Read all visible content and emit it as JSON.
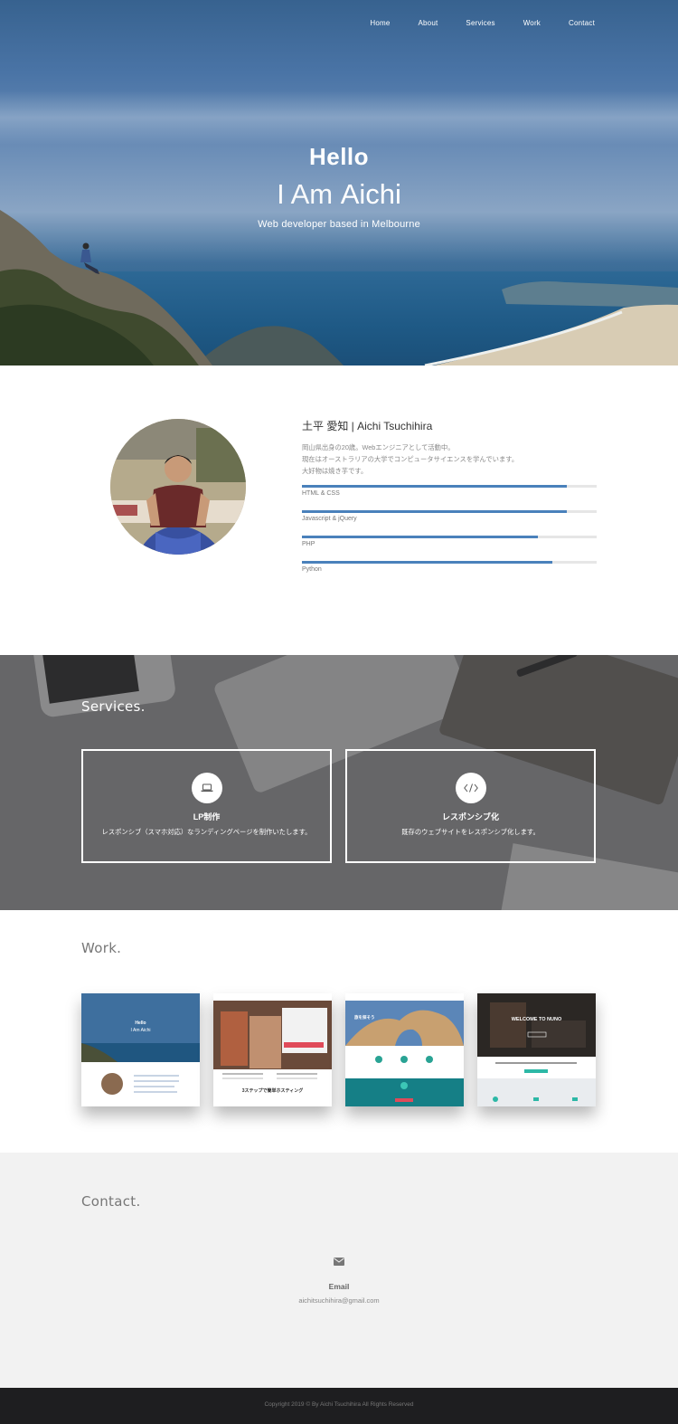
{
  "nav": {
    "items": [
      "Home",
      "About",
      "Services",
      "Work",
      "Contact"
    ]
  },
  "hero": {
    "hello": "Hello",
    "iam_prefix": "I Am",
    "iam_name": "Aichi",
    "subtitle": "Web developer based in Melbourne"
  },
  "about": {
    "name": "土平 愛知 | Aichi Tsuchihira",
    "desc_lines": [
      "岡山県出身の20歳。Webエンジニアとして活動中。",
      "現在はオーストラリアの大学でコンピュータサイエンスを学んでいます。",
      "大好物は焼き芋です。"
    ],
    "skills": [
      {
        "label": "HTML & CSS",
        "level": 0.9
      },
      {
        "label": "Javascript & jQuery",
        "level": 0.9
      },
      {
        "label": "PHP",
        "level": 0.8
      },
      {
        "label": "Python",
        "level": 0.85
      }
    ],
    "bar_color": "#4a81bb"
  },
  "services": {
    "title": "Services.",
    "cards": [
      {
        "icon": "laptop-icon",
        "title": "LP制作",
        "desc": "レスポンシブ（スマホ対応）なランディングページを制作いたします。"
      },
      {
        "icon": "code-icon",
        "title": "レスポンシブ化",
        "desc": "既存のウェブサイトをレスポンシブ化します。"
      }
    ]
  },
  "work": {
    "title": "Work.",
    "thumbs": [
      {
        "hero_title": "Hello",
        "hero_sub": "I Am Aichi"
      },
      {
        "headline": "3ステップで簡単ホスティング"
      },
      {
        "headline": "旅を探そう"
      },
      {
        "headline": "WELCOME TO NUNO"
      }
    ]
  },
  "contact": {
    "title": "Contact.",
    "icon": "envelope-icon",
    "label": "Email",
    "value": "aichitsuchihira@gmail.com"
  },
  "footer": {
    "text": "Copyright 2019 © By Aichi Tsuchihira All Rights Reserved"
  }
}
